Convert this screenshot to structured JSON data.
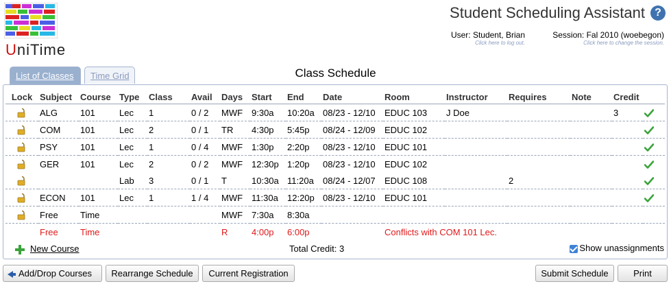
{
  "app": {
    "logo_letter": "U",
    "logo_rest": "niTime",
    "title": "Student Scheduling Assistant",
    "help_icon": "help-icon"
  },
  "header": {
    "user_text": "User: Student, Brian",
    "user_hint": "Click here to log out.",
    "session_text": "Session: Fal 2010 (woebegon)",
    "session_hint": "Click here to change the session."
  },
  "tabs": [
    {
      "label": "List of Classes",
      "active": true
    },
    {
      "label": "Time Grid",
      "active": false
    }
  ],
  "schedule": {
    "title": "Class Schedule",
    "columns": [
      "Lock",
      "Subject",
      "Course",
      "Type",
      "Class",
      "Avail",
      "Days",
      "Start",
      "End",
      "Date",
      "Room",
      "Instructor",
      "Requires",
      "Note",
      "Credit"
    ],
    "rows": [
      {
        "lock": true,
        "subject": "ALG",
        "course": "101",
        "type": "Lec",
        "class": "1",
        "avail": "0 / 2",
        "days": "MWF",
        "start": "9:30a",
        "end": "10:20a",
        "date": "08/23 - 12/10",
        "room": "EDUC 103",
        "instructor": "J Doe",
        "requires": "",
        "note": "",
        "credit": "3",
        "ok": true,
        "sep": true
      },
      {
        "lock": true,
        "subject": "COM",
        "course": "101",
        "type": "Lec",
        "class": "2",
        "avail": "0 / 1",
        "days": "TR",
        "start": "4:30p",
        "end": "5:45p",
        "date": "08/24 - 12/09",
        "room": "EDUC 102",
        "instructor": "",
        "requires": "",
        "note": "",
        "credit": "",
        "ok": true,
        "sep": true
      },
      {
        "lock": true,
        "subject": "PSY",
        "course": "101",
        "type": "Lec",
        "class": "1",
        "avail": "0 / 4",
        "days": "MWF",
        "start": "1:30p",
        "end": "2:20p",
        "date": "08/23 - 12/10",
        "room": "EDUC 101",
        "instructor": "",
        "requires": "",
        "note": "",
        "credit": "",
        "ok": true,
        "sep": true
      },
      {
        "lock": true,
        "subject": "GER",
        "course": "101",
        "type": "Lec",
        "class": "2",
        "avail": "0 / 2",
        "days": "MWF",
        "start": "12:30p",
        "end": "1:20p",
        "date": "08/23 - 12/10",
        "room": "EDUC 102",
        "instructor": "",
        "requires": "",
        "note": "",
        "credit": "",
        "ok": true,
        "sep": false
      },
      {
        "lock": true,
        "subject": "",
        "course": "",
        "type": "Lab",
        "class": "3",
        "avail": "0 / 1",
        "days": "T",
        "start": "10:30a",
        "end": "11:20a",
        "date": "08/24 - 12/07",
        "room": "EDUC 108",
        "instructor": "",
        "requires": "2",
        "note": "",
        "credit": "",
        "ok": true,
        "sep": true
      },
      {
        "lock": true,
        "subject": "ECON",
        "course": "101",
        "type": "Lec",
        "class": "1",
        "avail": "1 / 4",
        "days": "MWF",
        "start": "11:30a",
        "end": "12:20p",
        "date": "08/23 - 12/10",
        "room": "EDUC 101",
        "instructor": "",
        "requires": "",
        "note": "",
        "credit": "",
        "ok": true,
        "sep": true
      },
      {
        "lock": true,
        "subject": "Free",
        "course": "Time",
        "type": "",
        "class": "",
        "avail": "",
        "days": "MWF",
        "start": "7:30a",
        "end": "8:30a",
        "date": "",
        "room": "",
        "instructor": "",
        "requires": "",
        "note": "",
        "credit": "",
        "ok": false,
        "sep": true
      },
      {
        "lock": false,
        "subject": "Free",
        "course": "Time",
        "type": "",
        "class": "",
        "avail": "",
        "days": "R",
        "start": "4:00p",
        "end": "6:00p",
        "date": "",
        "room": "Conflicts with COM 101 Lec.",
        "instructor": "",
        "requires": "",
        "note": "",
        "credit": "",
        "ok": false,
        "sep": false,
        "red": true
      }
    ],
    "new_course_label": "New Course",
    "total_credit": "Total Credit: 3",
    "show_unassignments_label": "Show unassignments",
    "show_unassignments_checked": true
  },
  "buttons": {
    "add_drop": "Add/Drop Courses",
    "rearrange": "Rearrange Schedule",
    "current": "Current Registration",
    "submit": "Submit Schedule",
    "print": "Print"
  },
  "colors": {
    "accent": "#9ab0cf",
    "conflict": "#e0191b",
    "ok_check": "#3aa33a",
    "lock": "#d9a520"
  }
}
